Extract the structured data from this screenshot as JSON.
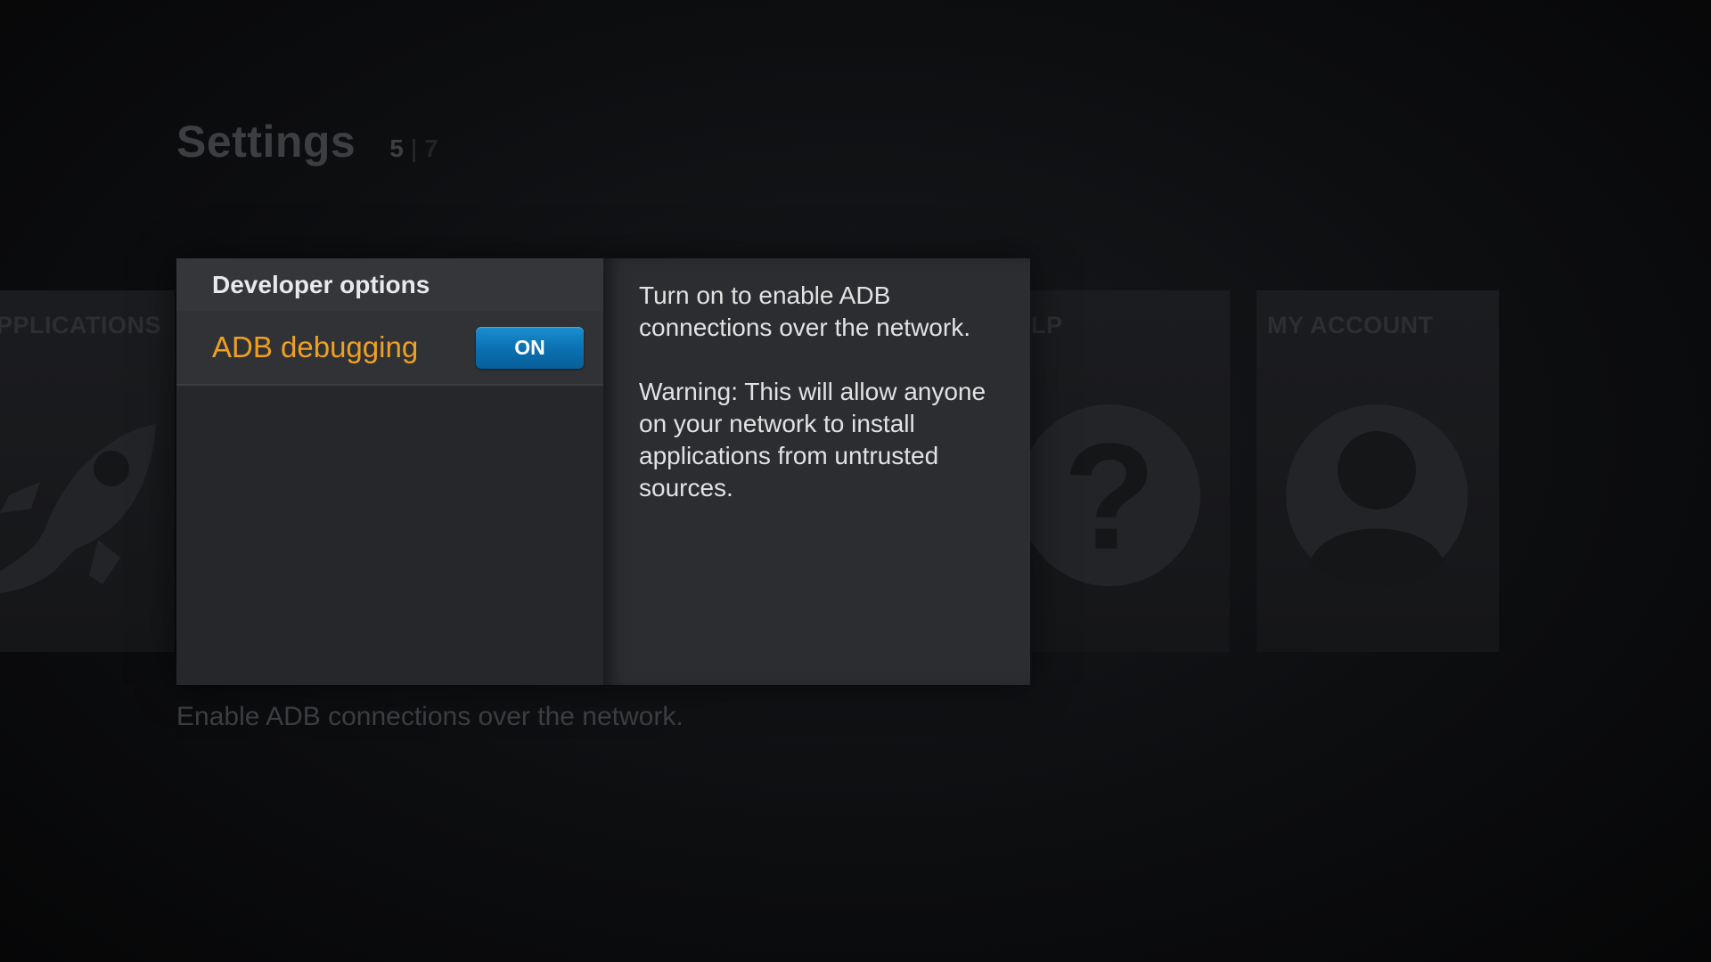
{
  "header": {
    "title": "Settings",
    "page_current": "5",
    "page_separator": "|",
    "page_total": "7"
  },
  "tiles": {
    "applications": {
      "label": "PPLICATIONS",
      "icon": "rocket-icon"
    },
    "help": {
      "label": "LP",
      "icon": "question-icon"
    },
    "my_account": {
      "label": "MY ACCOUNT",
      "icon": "user-icon"
    }
  },
  "dialog": {
    "section_title": "Developer options",
    "option": {
      "label": "ADB debugging",
      "toggle_value": "ON"
    },
    "description_line1": "Turn on to enable ADB connections over the network.",
    "description_line2": "Warning: This will allow anyone on your network to install applications from untrusted sources."
  },
  "footer": {
    "hint": "Enable ADB connections over the network."
  },
  "colors": {
    "accent_orange": "#f0a020",
    "toggle_blue": "#0a6fb0"
  }
}
